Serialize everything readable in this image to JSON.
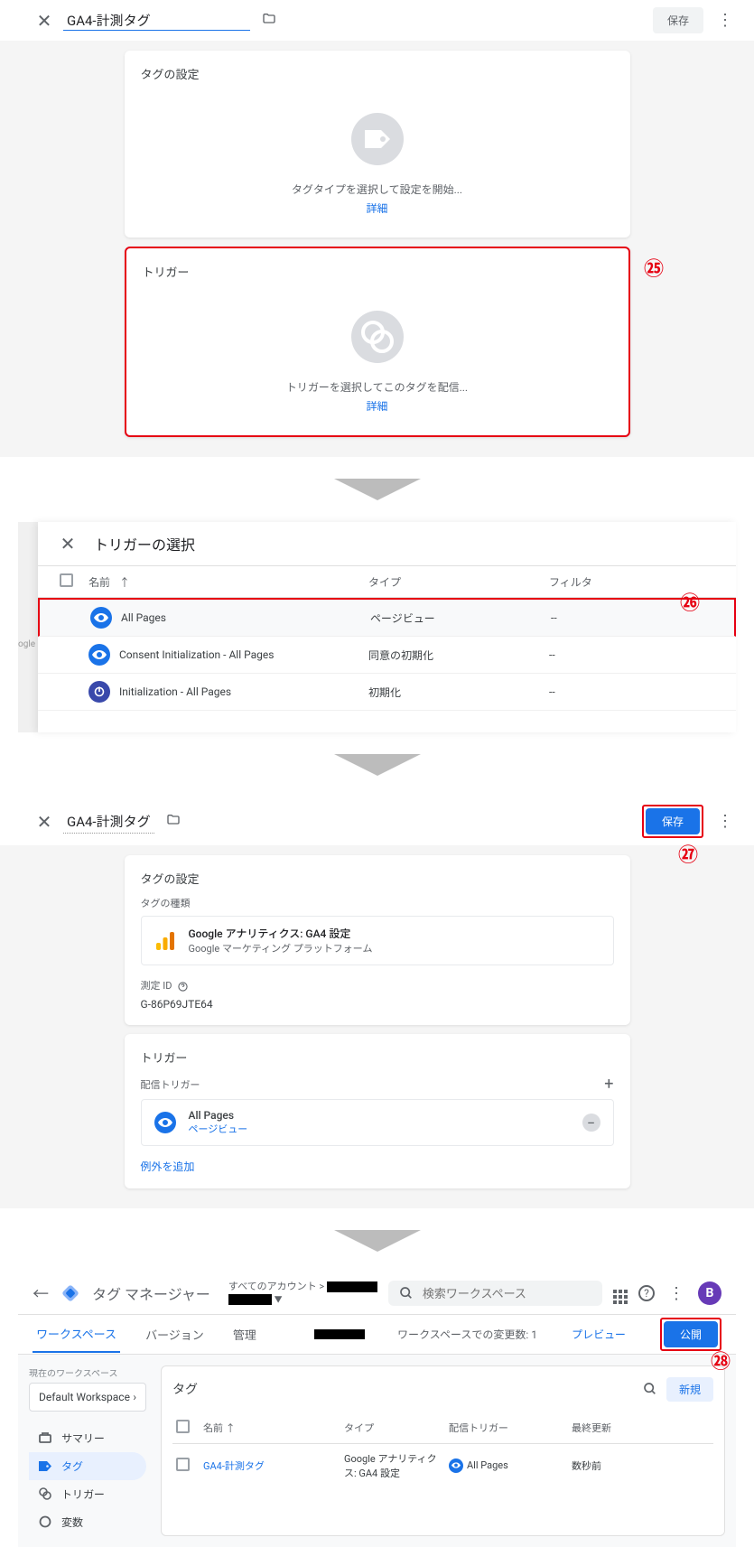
{
  "step25": {
    "title": "GA4-計測タグ",
    "save": "保存",
    "config_card": {
      "title": "タグの設定",
      "empty_text": "タグタイプを選択して設定を開始...",
      "detail": "詳細"
    },
    "trigger_card": {
      "title": "トリガー",
      "empty_text": "トリガーを選択してこのタグを配信...",
      "detail": "詳細"
    },
    "annotation": "㉕"
  },
  "step26": {
    "gutter_text": "ogle",
    "header": "トリガーの選択",
    "columns": {
      "name": "名前",
      "type": "タイプ",
      "filter": "フィルタ"
    },
    "rows": [
      {
        "name": "All Pages",
        "type": "ページビュー",
        "filter": "--",
        "icon": "eye",
        "color": "ic-blue"
      },
      {
        "name": "Consent Initialization - All Pages",
        "type": "同意の初期化",
        "filter": "--",
        "icon": "eye",
        "color": "ic-blue"
      },
      {
        "name": "Initialization - All Pages",
        "type": "初期化",
        "filter": "--",
        "icon": "power",
        "color": "ic-indigo"
      }
    ],
    "annotation": "㉖"
  },
  "step27": {
    "title": "GA4-計測タグ",
    "save": "保存",
    "annotation": "㉗",
    "config_card": {
      "title": "タグの設定",
      "tagtype_label": "タグの種類",
      "tagtype_name": "Google アナリティクス: GA4 設定",
      "tagtype_sub": "Google マーケティング プラットフォーム",
      "measid_label": "測定 ID",
      "measid_value": "G-86P69JTE64"
    },
    "trigger_card": {
      "title": "トリガー",
      "fire_label": "配信トリガー",
      "trigger_name": "All Pages",
      "trigger_type": "ページビュー",
      "exception_link": "例外を追加"
    }
  },
  "step28": {
    "app_title": "タグ マネージャー",
    "breadcrumb_top": "すべてのアカウント >",
    "search_placeholder": "検索ワークスペース",
    "avatar": "B",
    "tabs": {
      "workspace": "ワークスペース",
      "version": "バージョン",
      "admin": "管理"
    },
    "changes_text": "ワークスペースでの変更数: 1",
    "preview": "プレビュー",
    "publish": "公開",
    "annotation": "㉘",
    "sidebar": {
      "ws_label": "現在のワークスペース",
      "ws_name": "Default Workspace",
      "items": [
        {
          "label": "サマリー",
          "icon": "home"
        },
        {
          "label": "タグ",
          "icon": "tag",
          "active": true
        },
        {
          "label": "トリガー",
          "icon": "trigger"
        },
        {
          "label": "変数",
          "icon": "var"
        }
      ]
    },
    "taglist": {
      "title": "タグ",
      "new": "新規",
      "cols": {
        "name": "名前",
        "type": "タイプ",
        "trigger": "配信トリガー",
        "updated": "最終更新"
      },
      "rows": [
        {
          "name": "GA4-計測タグ",
          "type": "Google アナリティクス: GA4 設定",
          "trigger": "All Pages",
          "updated": "数秒前"
        }
      ]
    }
  }
}
